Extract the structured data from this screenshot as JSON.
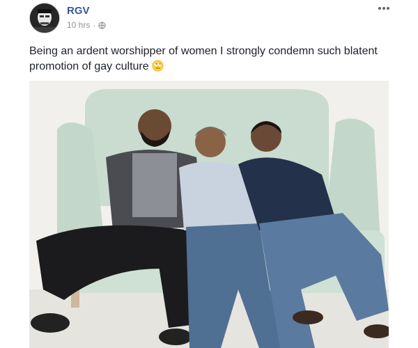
{
  "post": {
    "author": "RGV",
    "timestamp": "10 hrs",
    "separator": "·",
    "privacy_icon": "globe-icon",
    "more_icon": "more-options-icon",
    "caption": "Being an ardent worshipper of women I strongly condemn such blatent promotion of gay culture",
    "emoji_icon": "rolling-eyes-emoji-icon",
    "photo_icon": "photo-three-men-on-sofa"
  }
}
